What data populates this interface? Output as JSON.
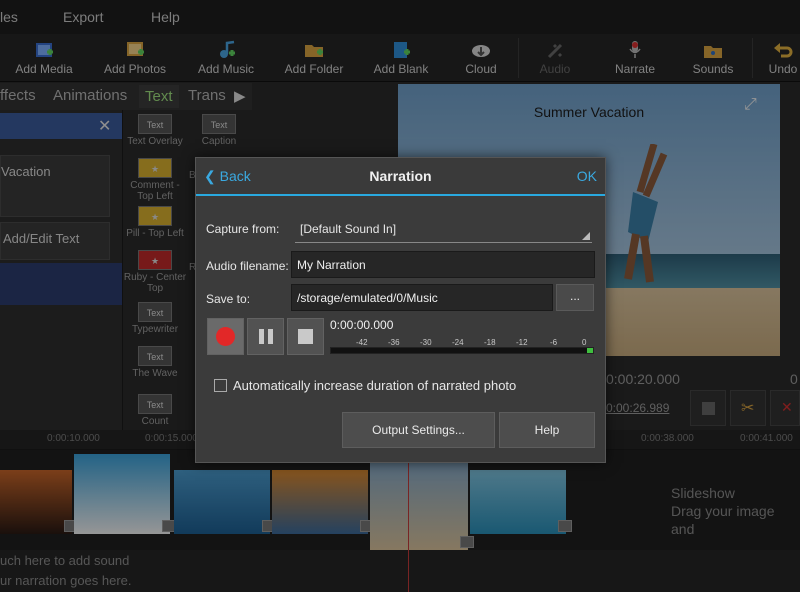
{
  "menu": {
    "items": [
      "les",
      "Export",
      "Help"
    ]
  },
  "toolbar": {
    "items": [
      {
        "label": "Add Media",
        "icon": "add-media-icon"
      },
      {
        "label": "Add Photos",
        "icon": "add-photos-icon"
      },
      {
        "label": "Add Music",
        "icon": "add-music-icon"
      },
      {
        "label": "Add Folder",
        "icon": "add-folder-icon"
      },
      {
        "label": "Add Blank",
        "icon": "add-blank-icon"
      },
      {
        "label": "Cloud",
        "icon": "cloud-icon"
      },
      {
        "label": "Audio",
        "icon": "audio-icon"
      },
      {
        "label": "Narrate",
        "icon": "microphone-icon"
      },
      {
        "label": "Sounds",
        "icon": "sounds-icon"
      },
      {
        "label": "Undo",
        "icon": "undo-icon"
      }
    ]
  },
  "tabs": {
    "items": [
      "ffects",
      "Animations",
      "Text",
      "Trans"
    ]
  },
  "left_panel": {
    "text_item": "Vacation",
    "add_edit": "Add/Edit Text",
    "close": "✕"
  },
  "thumbs": {
    "col1": [
      "Text Overlay",
      "Comment - Top Left",
      "Pill - Top Left",
      "Ruby - Center Top",
      "Typewriter",
      "The Wave",
      "Count"
    ],
    "col2": [
      "Caption",
      "B",
      "R"
    ],
    "box_text": "Text"
  },
  "preview": {
    "title": "Summer Vacation"
  },
  "timecodes": {
    "current": "0:00:20.000",
    "duration": "0:00:26.989",
    "right": "0"
  },
  "ruler": {
    "labels": [
      "0:00:10.000",
      "0:00:15.000",
      "0:00:38.000",
      "0:00:41.000"
    ]
  },
  "timeline": {
    "hint_title": "Slideshow",
    "hint_sub": "Drag your image and"
  },
  "audio_track": {
    "line1": "uch here to add sound",
    "line2": "ur narration goes here."
  },
  "dialog": {
    "back": "Back",
    "title": "Narration",
    "ok": "OK",
    "capture_label": "Capture from:",
    "capture_value": "[Default Sound In]",
    "filename_label": "Audio filename:",
    "filename_value": "My Narration",
    "save_label": "Save to:",
    "save_value": "/storage/emulated/0/Music",
    "browse": "...",
    "time": "0:00:00.000",
    "meter_scale": [
      "-42",
      "-36",
      "-30",
      "-24",
      "-18",
      "-12",
      "-6",
      "0"
    ],
    "auto_duration": "Automatically increase duration of narrated photo",
    "output_settings": "Output Settings...",
    "help": "Help"
  },
  "colors": {
    "accent": "#29a9e0",
    "record": "#e22828",
    "text_tab": "#9ee07f"
  }
}
